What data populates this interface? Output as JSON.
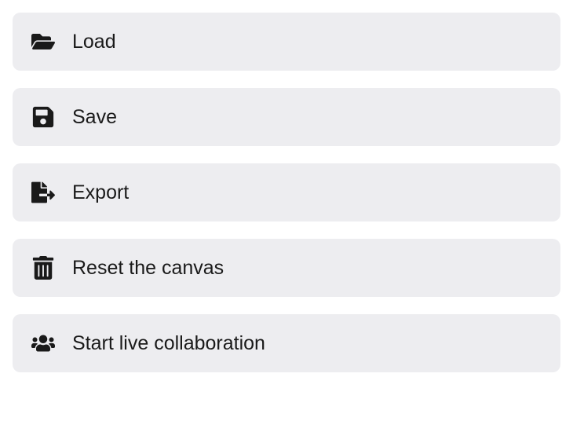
{
  "menu": {
    "items": [
      {
        "id": "load",
        "label": "Load",
        "icon": "folder-open-icon"
      },
      {
        "id": "save",
        "label": "Save",
        "icon": "save-icon"
      },
      {
        "id": "export",
        "label": "Export",
        "icon": "export-icon"
      },
      {
        "id": "reset",
        "label": "Reset the canvas",
        "icon": "trash-icon"
      },
      {
        "id": "collab",
        "label": "Start live collaboration",
        "icon": "users-icon"
      }
    ]
  }
}
